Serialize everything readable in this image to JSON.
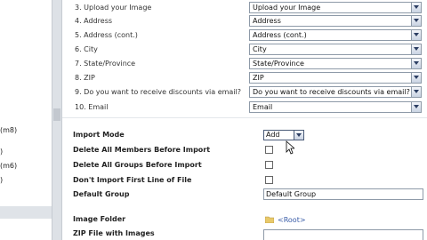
{
  "sidebar": {
    "frag1": "(m8)",
    "frag2": ")",
    "frag3": "(m6)",
    "frag4": ")"
  },
  "fields": [
    {
      "label": "3. Upload your Image",
      "value": "Upload your Image"
    },
    {
      "label": "4. Address",
      "value": "Address"
    },
    {
      "label": "5. Address (cont.)",
      "value": "Address (cont.)"
    },
    {
      "label": "6. City",
      "value": "City"
    },
    {
      "label": "7. State/Province",
      "value": "State/Province"
    },
    {
      "label": "8. ZIP",
      "value": "ZIP"
    },
    {
      "label": "9. Do you want to receive discounts via email?",
      "value": "Do you want to receive discounts via email?"
    },
    {
      "label": "10. Email",
      "value": "Email"
    }
  ],
  "options": {
    "import_mode_label": "Import Mode",
    "import_mode_value": "Add",
    "delete_members_label": "Delete All Members Before Import",
    "delete_groups_label": "Delete All Groups Before Import",
    "dont_import_first_line_label": "Don't Import First Line of File",
    "default_group_label": "Default Group",
    "default_group_value": "Default Group",
    "image_folder_label": "Image Folder",
    "image_folder_value": "<Root>",
    "zip_file_label": "ZIP File with Images"
  },
  "colors": {
    "link": "#3a5da8",
    "folder": "#e8c96a"
  }
}
